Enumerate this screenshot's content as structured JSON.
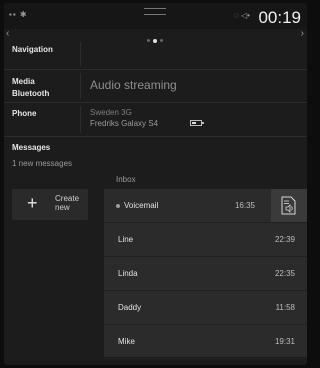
{
  "status_bar": {
    "clock": "00:19"
  },
  "sections": {
    "navigation": {
      "label": "Navigation"
    },
    "media": {
      "label_line1": "Media",
      "label_line2": "Bluetooth",
      "value": "Audio streaming"
    },
    "phone": {
      "label": "Phone",
      "carrier": "Sweden 3G",
      "device": "Fredriks Galaxy S4"
    },
    "messages": {
      "label": "Messages",
      "count_text": "1 new messages"
    }
  },
  "create": {
    "line1": "Create",
    "line2": "new"
  },
  "inbox": {
    "label": "Inbox",
    "items": [
      {
        "name": "Voicemail",
        "time": "16:35",
        "unread": true
      },
      {
        "name": "Line",
        "time": "22:39"
      },
      {
        "name": "Linda",
        "time": "22:35"
      },
      {
        "name": "Daddy",
        "time": "11:58"
      },
      {
        "name": "Mike",
        "time": "19:31"
      }
    ]
  },
  "icons": [
    "bluetooth-icon",
    "signal-icon",
    "volume-icon",
    "battery-icon",
    "plus-icon",
    "speaker-listen-icon",
    "chevron-left-icon",
    "chevron-right-icon"
  ]
}
